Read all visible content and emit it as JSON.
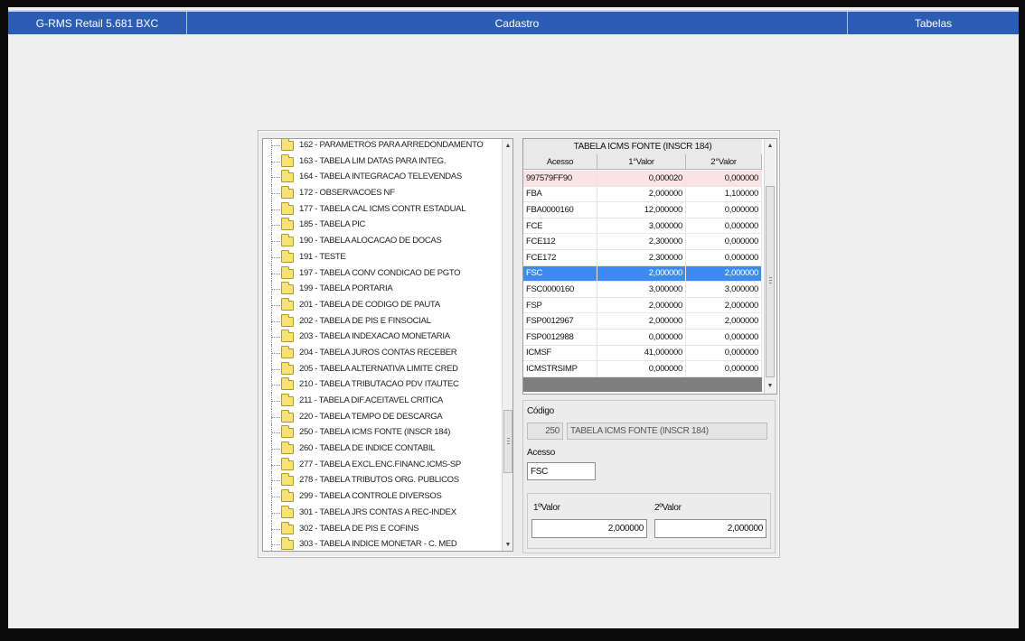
{
  "topbar": {
    "app_title": "G-RMS Retail 5.681 BXC",
    "screen_title": "Cadastro",
    "tab_label": "Tabelas"
  },
  "tree": {
    "items": [
      "162 - PARAMETROS PARA ARREDONDAMENTO",
      "163 - TABELA LIM  DATAS PARA INTEG.",
      "164 - TABELA INTEGRACAO TELEVENDAS",
      "172 - OBSERVACOES NF",
      "177 - TABELA CAL ICMS CONTR ESTADUAL",
      "185 - TABELA PIC",
      "190 - TABELA ALOCACAO DE DOCAS",
      "191 - TESTE",
      "197 - TABELA CONV  CONDICAO DE PGTO",
      "199 - TABELA PORTARIA",
      "201 - TABELA DE CODIGO DE PAUTA",
      "202 - TABELA DE PIS E FINSOCIAL",
      "203 - TABELA INDEXACAO MONETARIA",
      "204 - TABELA JUROS CONTAS RECEBER",
      "205 - TABELA ALTERNATIVA LIMITE CRED",
      "210 - TABELA TRIBUTACAO PDV ITAUTEC",
      "211 - TABELA DIF.ACEITAVEL  CRITICA",
      "220 - TABELA TEMPO DE DESCARGA",
      "250 - TABELA ICMS FONTE (INSCR 184)",
      "260 - TABELA DE INDICE CONTABIL",
      "277 - TABELA EXCL.ENC.FINANC.ICMS-SP",
      "278 - TABELA TRIBUTOS ORG. PUBLICOS",
      "299 - TABELA CONTROLE DIVERSOS",
      "301 - TABELA JRS CONTAS A REC-INDEX",
      "302 - TABELA DE PIS E COFINS",
      "303 - TABELA INDICE MONETAR - C. MED"
    ]
  },
  "grid": {
    "title": "TABELA ICMS FONTE (INSCR 184)",
    "headers": [
      "Acesso",
      "1°Valor",
      "2°Valor"
    ],
    "rows": [
      [
        "997579FF90",
        "0,000020",
        "0,000000"
      ],
      [
        "FBA",
        "2,000000",
        "1,100000"
      ],
      [
        "FBA0000160",
        "12,000000",
        "0,000000"
      ],
      [
        "FCE",
        "3,000000",
        "0,000000"
      ],
      [
        "FCE112",
        "2,300000",
        "0,000000"
      ],
      [
        "FCE172",
        "2,300000",
        "0,000000"
      ],
      [
        "FSC",
        "2,000000",
        "2,000000"
      ],
      [
        "FSC0000160",
        "3,000000",
        "3,000000"
      ],
      [
        "FSP",
        "2,000000",
        "2,000000"
      ],
      [
        "FSP0012967",
        "2,000000",
        "2,000000"
      ],
      [
        "FSP0012988",
        "0,000000",
        "0,000000"
      ],
      [
        "ICMSF",
        "41,000000",
        "0,000000"
      ],
      [
        "ICMSTRSIMP",
        "0,000000",
        "0,000000"
      ]
    ],
    "selected_row": 6,
    "highlighted_row": 0
  },
  "detail": {
    "codigo_label": "Código",
    "codigo_value": "250",
    "descricao_value": "TABELA ICMS FONTE (INSCR 184)",
    "acesso_label": "Acesso",
    "acesso_value": "FSC",
    "valor1_label": "1ºValor",
    "valor1_value": "2,000000",
    "valor2_label": "2ºValor",
    "valor2_value": "2,000000"
  },
  "colors": {
    "topbar": "#2b5db5",
    "selection": "#3d8bf0",
    "highlight_row": "#fbe3e3"
  },
  "icons": {
    "tree_node": "folder-icon",
    "scroll_up": "scroll-up-arrow-icon",
    "scroll_down": "scroll-down-arrow-icon"
  }
}
